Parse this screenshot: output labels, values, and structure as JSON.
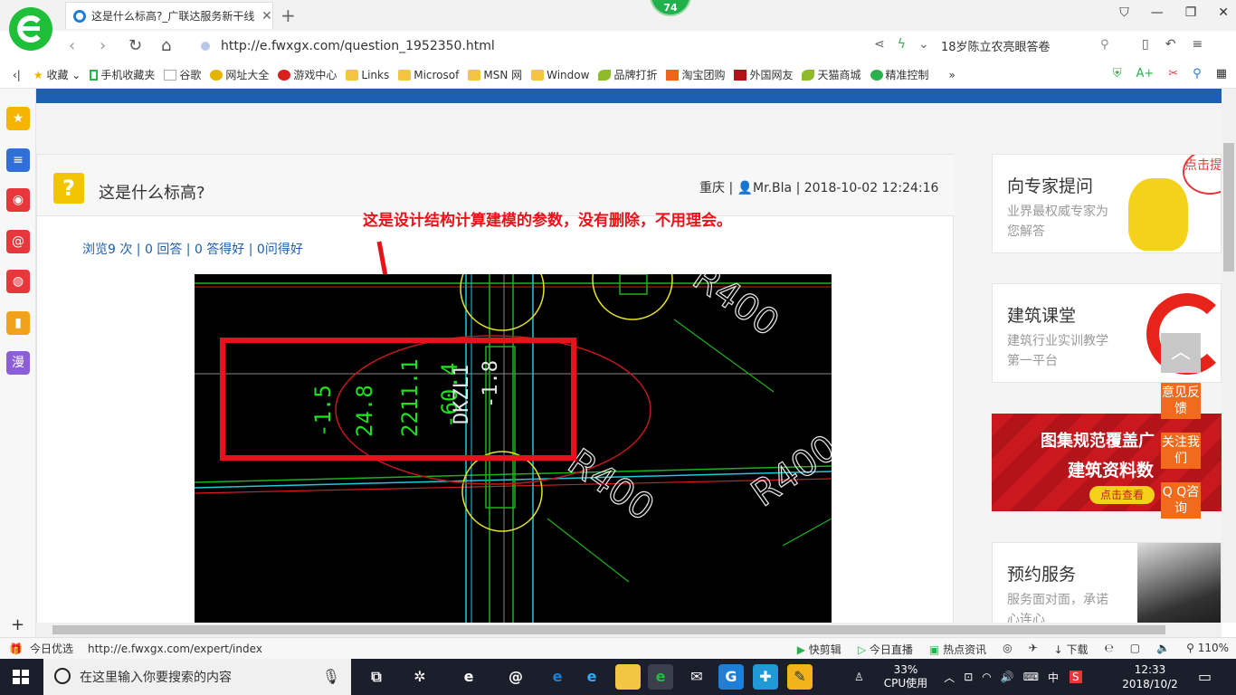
{
  "browser": {
    "tab_title": "这是什么标高?_广联达服务新干线",
    "tab_close": "✕",
    "new_tab": "+",
    "badge": "74",
    "url": "http://e.fwxgx.com/question_1952350.html",
    "hot_search": "18岁陈立农亮眼答卷"
  },
  "bookmarks": {
    "items": [
      {
        "label": "收藏",
        "icon": "star-icon"
      },
      {
        "label": "手机收藏夹",
        "icon": "phone-icon"
      },
      {
        "label": "谷歌",
        "icon": "page-icon"
      },
      {
        "label": "网址大全",
        "icon": "globe-icon"
      },
      {
        "label": "游戏中心",
        "icon": "game-icon"
      },
      {
        "label": "Links",
        "icon": "folder-icon"
      },
      {
        "label": "Microsof",
        "icon": "folder-icon"
      },
      {
        "label": "MSN 网",
        "icon": "folder-icon"
      },
      {
        "label": "Window",
        "icon": "folder-icon"
      },
      {
        "label": "品牌打折",
        "icon": "leaf-icon"
      },
      {
        "label": "淘宝团购",
        "icon": "taobao-icon"
      },
      {
        "label": "外国网友",
        "icon": "foreign-icon"
      },
      {
        "label": "天猫商城",
        "icon": "leaf-icon"
      },
      {
        "label": "精准控制",
        "icon": "wechat-icon"
      }
    ],
    "more": "»"
  },
  "sidebar": {
    "items": [
      {
        "icon": "favorites-star-icon",
        "glyph": "★",
        "color": "#f5b400"
      },
      {
        "icon": "news-icon",
        "glyph": "≡",
        "color": "#2f6fd6"
      },
      {
        "icon": "weibo-icon",
        "glyph": "◉",
        "color": "#e8373a"
      },
      {
        "icon": "mail-icon",
        "glyph": "@",
        "color": "#e8373a"
      },
      {
        "icon": "game-controller-icon",
        "glyph": "◍",
        "color": "#e8373a"
      },
      {
        "icon": "book-icon",
        "glyph": "▮",
        "color": "#f2a21a"
      },
      {
        "icon": "comic-icon",
        "glyph": "漫",
        "color": "#8c5fd6"
      }
    ],
    "add": "+"
  },
  "question": {
    "icon_glyph": "?",
    "title": "这是什么标高?",
    "meta": "重庆 | 👤Mr.Bla | 2018-10-02 12:24:16",
    "annotation": "这是设计结构计算建模的参数，没有删除，不用理会。",
    "stats": "浏览9 次 | 0 回答 | 0 答得好 | 0问得好"
  },
  "cad": {
    "labels": [
      "-1.5",
      "24.8",
      "2211.1",
      "-60.4",
      "DKZL1",
      "-1.8"
    ],
    "r_labels": [
      "R400",
      "R400",
      "R400"
    ]
  },
  "right_cards": [
    {
      "title": "向专家提问",
      "subtitle": "业界最权威专家为您解答",
      "bubble": "点击提问"
    },
    {
      "title": "建筑课堂",
      "subtitle": "建筑行业实训教学第一平台"
    },
    {
      "title": "预约服务",
      "subtitle": "服务面对面，承诺心连心"
    }
  ],
  "ad_banner": {
    "line1": "图集规范覆盖广",
    "line2": "建筑资料数",
    "button": "点击查看"
  },
  "float_buttons": {
    "top": "︿",
    "feedback": "意见反馈",
    "follow": "关注我们",
    "qq": "Q Q咨询"
  },
  "statusbar": {
    "left_label": "今日优选",
    "url": "http://e.fwxgx.com/expert/index",
    "right": [
      "快剪辑",
      "今日直播",
      "热点资讯",
      "下载",
      "110%"
    ]
  },
  "taskbar": {
    "search_placeholder": "在这里输入你要搜索的内容",
    "cpu_percent": "33%",
    "cpu_label": "CPU使用",
    "ime": "中",
    "time": "12:33",
    "date": "2018/10/2"
  }
}
